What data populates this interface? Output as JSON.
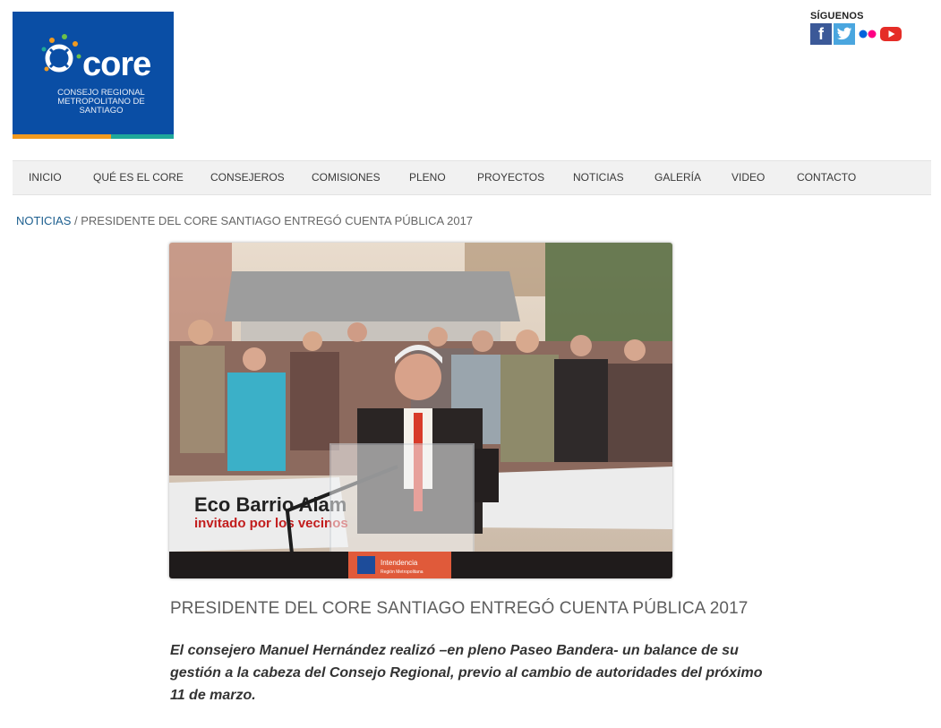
{
  "logo": {
    "word": "core",
    "subtitle": "CONSEJO REGIONAL METROPOLITANO DE SANTIAGO",
    "bg": "#0a4ea5"
  },
  "social": {
    "title": "SÍGUENOS",
    "icons": [
      "facebook-icon",
      "twitter-icon",
      "flickr-icon",
      "youtube-icon"
    ],
    "facebook_glyph": "f"
  },
  "nav": {
    "items": [
      "INICIO",
      "QUÉ ES EL CORE",
      "CONSEJEROS",
      "COMISIONES",
      "PLENO",
      "PROYECTOS",
      "NOTICIAS",
      "GALERÍA",
      "VIDEO",
      "CONTACTO"
    ]
  },
  "breadcrumb": {
    "section": "NOTICIAS",
    "separator": " / ",
    "current": "PRESIDENTE DEL CORE SANTIAGO ENTREGÓ CUENTA PÚBLICA 2017"
  },
  "hero": {
    "banner_line1": "Eco Barrio Alam",
    "banner_line2": "invitado por los vecinos",
    "podium_label": "Intendencia",
    "podium_sub": "Región Metropolitana"
  },
  "article": {
    "title": "PRESIDENTE DEL CORE SANTIAGO ENTREGÓ CUENTA PÚBLICA 2017",
    "lead": "El consejero Manuel Hernández realizó –en pleno Paseo Bandera- un balance de su gestión a la cabeza del Consejo Regional, previo al cambio de autoridades del próximo 11 de marzo."
  }
}
